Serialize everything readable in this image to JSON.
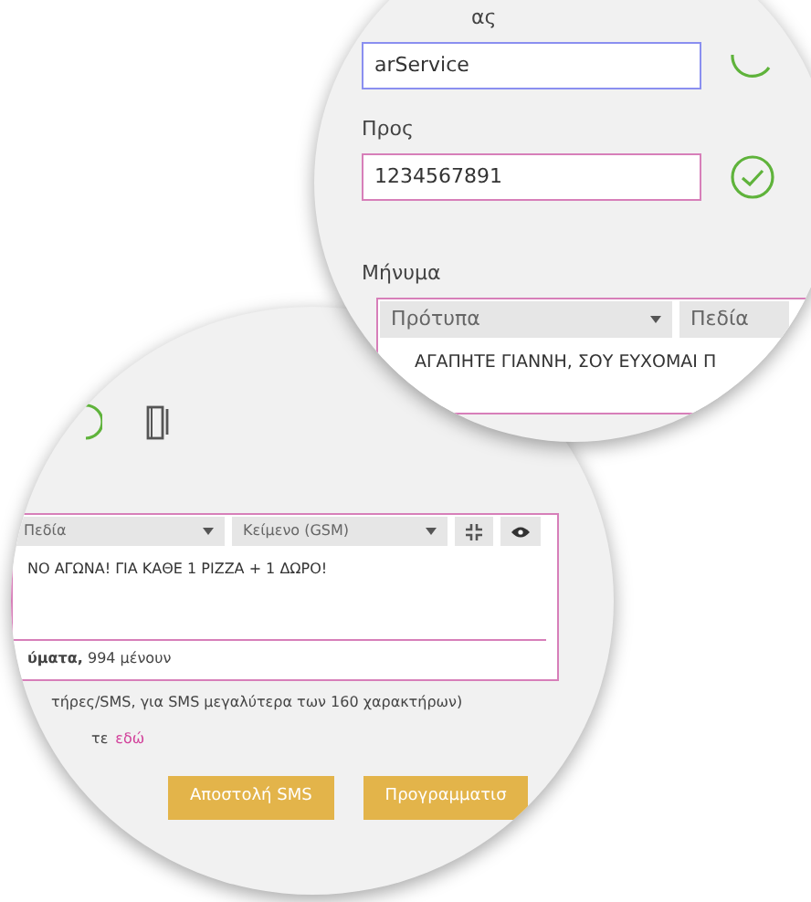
{
  "back_lens": {
    "editor": {
      "selects": [
        {
          "label": "Πεδία",
          "kind": "select"
        },
        {
          "label": "Κείμενο (GSM)",
          "kind": "select"
        },
        {
          "kind": "fullscreen"
        },
        {
          "kind": "preview"
        }
      ],
      "message_text": "ΝΟ ΑΓΩΝΑ! ΓΙΑ ΚΑΘΕ 1 PIZZA + 1 ΔΩΡΟ!",
      "counter": "**ύματα,** 994 μένουν"
    },
    "note": "τήρες/SMS, για SMS μεγαλύτερα των 160 χαρακτήρων)",
    "help_text": "τε",
    "help_link": "εδώ",
    "buttons": [
      "Αποστολή SMS",
      "Προγραμματισ"
    ]
  },
  "front_lens": {
    "fields": [
      {
        "label": "ας",
        "value": "arService",
        "focused": true
      },
      {
        "label": "Προς",
        "value": "1234567891",
        "focused": false
      }
    ],
    "message_label": "Μήνυμα",
    "selects": [
      {
        "label": "Πρότυπα",
        "kind": "select"
      },
      {
        "label": "Πεδία",
        "kind": "select"
      }
    ],
    "message_text": "ΑΓΑΠΗΤΕ ΓΙΑΝΝΗ, ΣΟΥ ΕΥΧΟΜΑΙ Π"
  }
}
